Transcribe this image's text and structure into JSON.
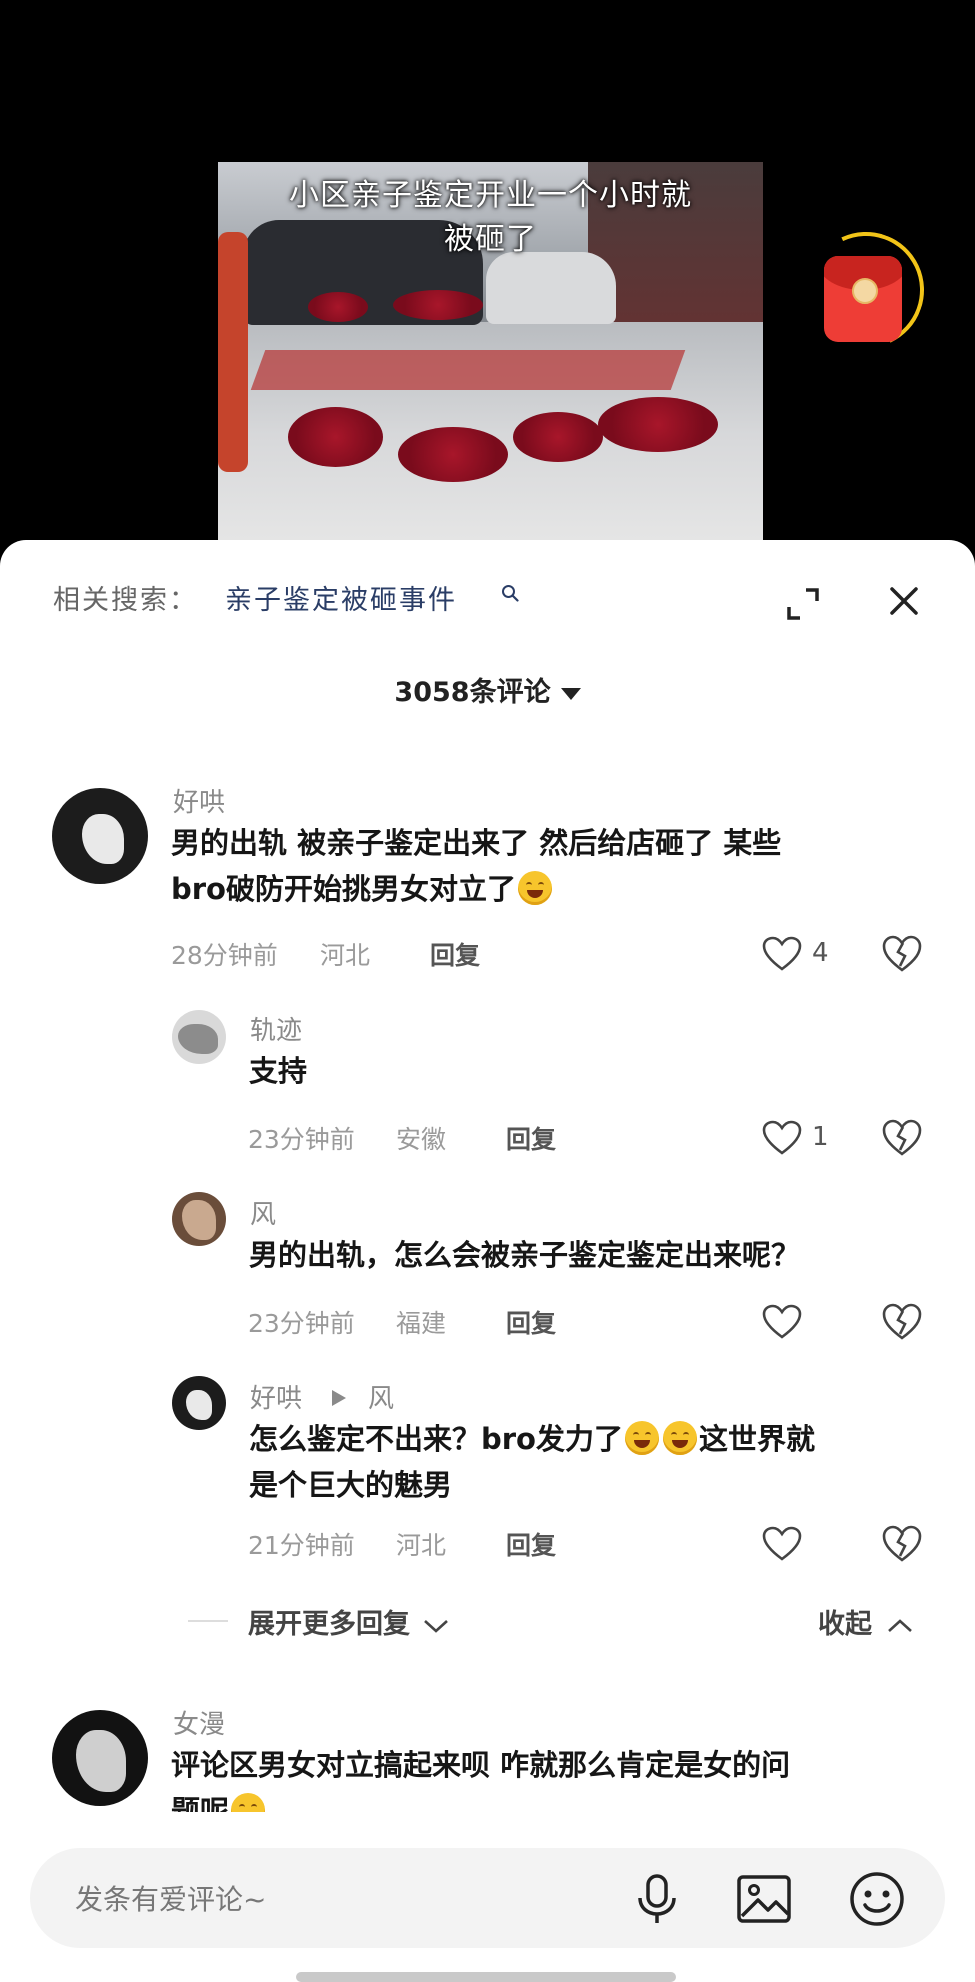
{
  "video": {
    "caption_line1": "小区亲子鉴定开业一个小时就",
    "caption_line2": "被砸了"
  },
  "panel": {
    "related_label": "相关搜索：",
    "related_query": "亲子鉴定被砸事件",
    "comment_count_title": "3058条评论"
  },
  "comments": [
    {
      "user": "好哄",
      "text_line1": "男的出轨 被亲子鉴定出来了 然后给店砸了 某些",
      "text_line2": "bro破防开始挑男女对立了",
      "emoji": "hugging-face",
      "time": "28分钟前",
      "location": "河北",
      "reply_label": "回复",
      "likes": "4"
    },
    {
      "user": "轨迹",
      "text_line1": "支持",
      "time": "23分钟前",
      "location": "安徽",
      "reply_label": "回复",
      "likes": "1"
    },
    {
      "user": "风",
      "text_line1": "男的出轨，怎么会被亲子鉴定鉴定出来呢？",
      "time": "23分钟前",
      "location": "福建",
      "reply_label": "回复",
      "likes": ""
    },
    {
      "user": "好哄",
      "reply_to": "风",
      "text_line1a": "怎么鉴定不出来？bro发力了",
      "text_line1b": "这世界就",
      "text_line2": "是个巨大的魅男",
      "emoji": "laughing-tears",
      "time": "21分钟前",
      "location": "河北",
      "reply_label": "回复",
      "likes": ""
    },
    {
      "user": "女漫",
      "text_line1": "评论区男女对立搞起来呗 咋就那么肯定是女的问",
      "text_line2": "题呢"
    }
  ],
  "thread_controls": {
    "expand_more": "展开更多回复",
    "collapse": "收起"
  },
  "input": {
    "placeholder": "发条有爱评论~"
  },
  "colors": {
    "sheet_bg": "#ffffff",
    "input_bg": "#f3f3f3",
    "related_query": "#2a3d66",
    "red_packet": "#ee3d36",
    "ring": "#f2c418"
  }
}
